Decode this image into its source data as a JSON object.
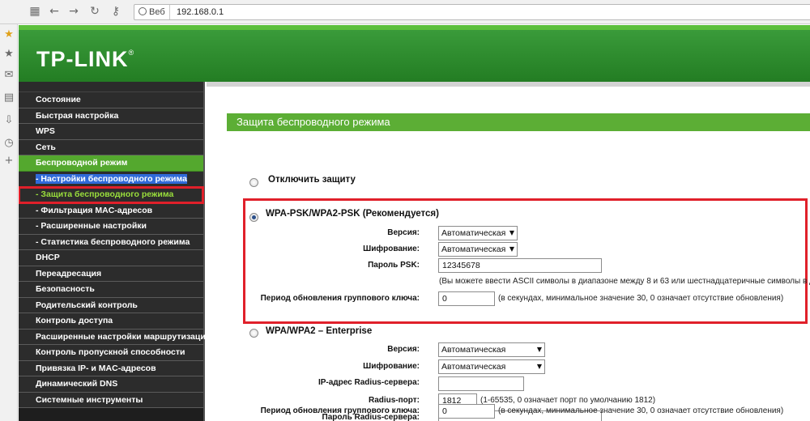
{
  "browser": {
    "site_label": "Веб",
    "url": "192.168.0.1"
  },
  "brand": {
    "logo": "TP-LINK",
    "registered_mark": "®"
  },
  "menu": {
    "items": [
      {
        "label": "Состояние"
      },
      {
        "label": "Быстрая настройка"
      },
      {
        "label": "WPS"
      },
      {
        "label": "Сеть"
      },
      {
        "label": "Беспроводной режим"
      },
      {
        "label": "- Настройки беспроводного режима"
      },
      {
        "label": "- Защита беспроводного режима"
      },
      {
        "label": "- Фильтрация MAC-адресов"
      },
      {
        "label": "- Расширенные настройки"
      },
      {
        "label": "- Статистика беспроводного режима"
      },
      {
        "label": "DHCP"
      },
      {
        "label": "Переадресация"
      },
      {
        "label": "Безопасность"
      },
      {
        "label": "Родительский контроль"
      },
      {
        "label": "Контроль доступа"
      },
      {
        "label": "Расширенные настройки маршрутизации"
      },
      {
        "label": "Контроль пропускной способности"
      },
      {
        "label": "Привязка IP- и MAC-адресов"
      },
      {
        "label": "Динамический DNS"
      },
      {
        "label": "Системные инструменты"
      }
    ]
  },
  "page": {
    "section_title": "Защита беспроводного режима",
    "disable": {
      "label": "Отключить защиту"
    },
    "psk": {
      "label": "WPA-PSK/WPA2-PSK (Рекомендуется)",
      "version_label": "Версия:",
      "version_value": "Автоматическая",
      "encryption_label": "Шифрование:",
      "encryption_value": "Автоматическая",
      "password_label": "Пароль PSK:",
      "password_value": "12345678",
      "password_hint": "(Вы можете ввести ASCII символы в диапазоне между 8 и 63 или шестнадцатеричные символы в д",
      "group_key_label": "Период обновления группового ключа:",
      "group_key_value": "0",
      "group_key_hint": "(в секундах, минимальное значение 30, 0 означает отсутствие обновления)"
    },
    "enterprise": {
      "label": "WPA/WPA2 – Enterprise",
      "version_label": "Версия:",
      "version_value": "Автоматическая",
      "encryption_label": "Шифрование:",
      "encryption_value": "Автоматическая",
      "radius_ip_label": "IP-адрес Radius-сервера:",
      "radius_ip_value": "",
      "radius_port_label": "Radius-порт:",
      "radius_port_value": "1812",
      "radius_port_hint": "(1-65535, 0 означает порт по умолчанию 1812)",
      "radius_password_label": "Пароль Radius-сервера:",
      "radius_password_value": "",
      "group_key_label": "Период обновления группового ключа:",
      "group_key_value": "0",
      "group_key_hint": "(в секундах, минимальное значение 30, 0 означает отсутствие обновления)"
    }
  },
  "colors": {
    "brand_green": "#237d23",
    "menu_active": "#54a82e",
    "section_bar": "#5cae35",
    "highlight_red": "#e0202a"
  }
}
